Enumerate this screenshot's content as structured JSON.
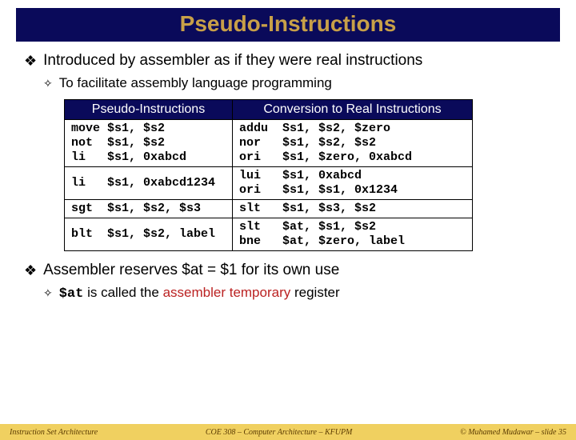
{
  "title": "Pseudo-Instructions",
  "bullets": {
    "intro": "Introduced by assembler as if they were real instructions",
    "intro_sub": "To facilitate assembly language programming",
    "reserve_pre": "Assembler reserves $at = $1 for its own use",
    "reserve_sub_code": "$at",
    "reserve_sub_mid": " is called the ",
    "reserve_sub_hl": "assembler temporary",
    "reserve_sub_end": " register"
  },
  "table": {
    "head_pseudo": "Pseudo-Instructions",
    "head_real": "Conversion to Real Instructions",
    "rows": [
      {
        "p": "move $s1, $s2\nnot  $s1, $s2\nli   $s1, 0xabcd",
        "r": "addu  Ss1, $s2, $zero\nnor   $s1, $s2, $s2\nori   $s1, $zero, 0xabcd"
      },
      {
        "p": "li   $s1, 0xabcd1234",
        "r": "lui   $s1, 0xabcd\nori   $s1, $s1, 0x1234"
      },
      {
        "p": "sgt  $s1, $s2, $s3",
        "r": "slt   $s1, $s3, $s2"
      },
      {
        "p": "blt  $s1, $s2, label",
        "r": "slt   $at, $s1, $s2\nbne   $at, $zero, label"
      }
    ]
  },
  "footer": {
    "left": "Instruction Set Architecture",
    "center": "COE 308 – Computer Architecture – KFUPM",
    "right": "© Muhamed Mudawar – slide 35"
  }
}
